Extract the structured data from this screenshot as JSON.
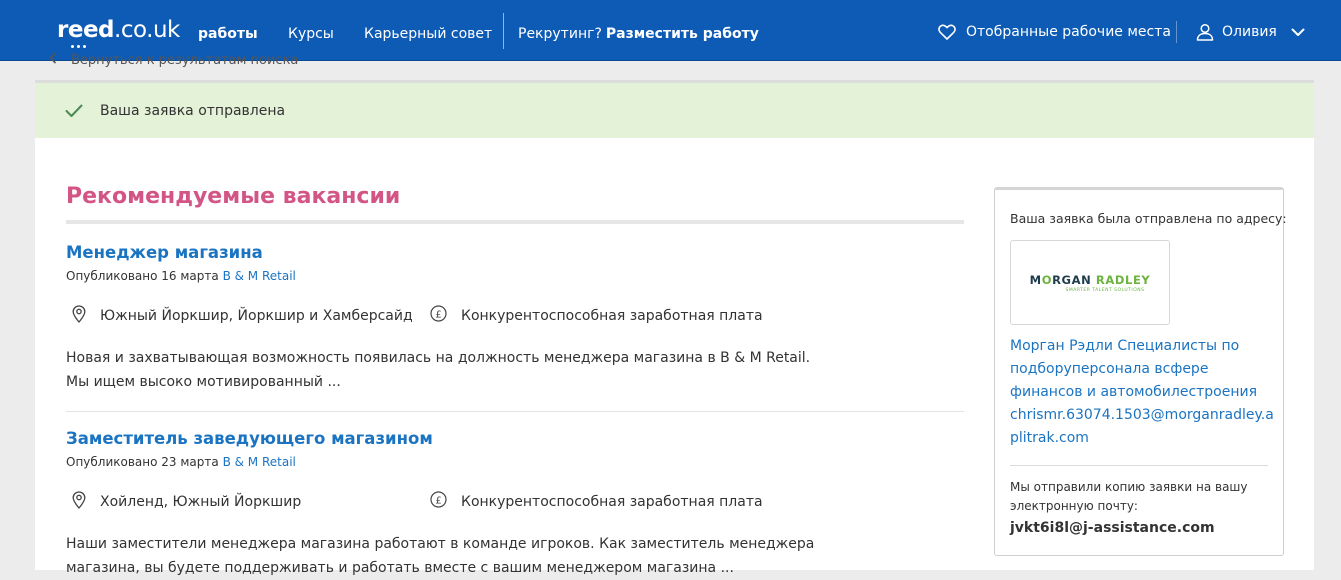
{
  "header": {
    "logo_main": "reed",
    "logo_suffix": ".co.uk",
    "nav": {
      "jobs": "работы",
      "courses": "Курсы",
      "career": "Карьерный совет",
      "recruiting": "Рекрутинг?",
      "post_job": "Разместить работу"
    },
    "saved_jobs": "Отобранные рабочие места",
    "user_name": "Оливия"
  },
  "back_link": "Вернуться к результатам поиска",
  "alert": {
    "message": "Ваша заявка отправлена"
  },
  "recommended": {
    "title": "Рекомендуемые вакансии",
    "jobs": [
      {
        "title": "Менеджер магазина",
        "posted": "Опубликовано 16 марта",
        "company": "B & M Retail",
        "location": "Южный Йоркшир, Йоркшир и Хамберсайд",
        "salary": "Конкурентоспособная заработная плата",
        "description_line1": "Новая и захватывающая возможность появилась на должность менеджера магазина в B & M Retail.",
        "description_line2": "Мы ищем высоко мотивированный ..."
      },
      {
        "title": "Заместитель заведующего магазином",
        "posted": "Опубликовано 23 марта",
        "company": "B & M Retail",
        "location": "Хойленд, Южный Йоркшир",
        "salary": "Конкурентоспособная заработная плата",
        "description_line1": "Наши заместители менеджера магазина работают в команде игроков. Как заместитель менеджера",
        "description_line2": "магазина, вы будете поддерживать и работать вместе с вашим менеджером магазина ..."
      }
    ]
  },
  "sidebar": {
    "sent_to_label": "Ваша заявка была отправлена по адресу:",
    "recruiter_logo_text_1": "M",
    "recruiter_logo_text_o": "O",
    "recruiter_logo_text_2": "RGAN",
    "recruiter_logo_text_3": "RADLEY",
    "recruiter_logo_tagline": "SMARTER TALENT SOLUTIONS",
    "recruiter_name": "Морган Рэдли Специалисты по подборуперсонала всфере финансов и автомобилестроения",
    "recruiter_email": "chrismr.63074.1503@morganradley.aplitrak.com",
    "copy_notice": "Мы отправили копию заявки на вашу электронную почту:",
    "user_email": "jvkt6i8l@j-assistance.com"
  },
  "colors": {
    "header_bg": "#0e5bb5",
    "accent_pink": "#d35586",
    "link_blue": "#1b74c2",
    "success_bg": "#e4f2d8",
    "check_green": "#4c8a55"
  }
}
